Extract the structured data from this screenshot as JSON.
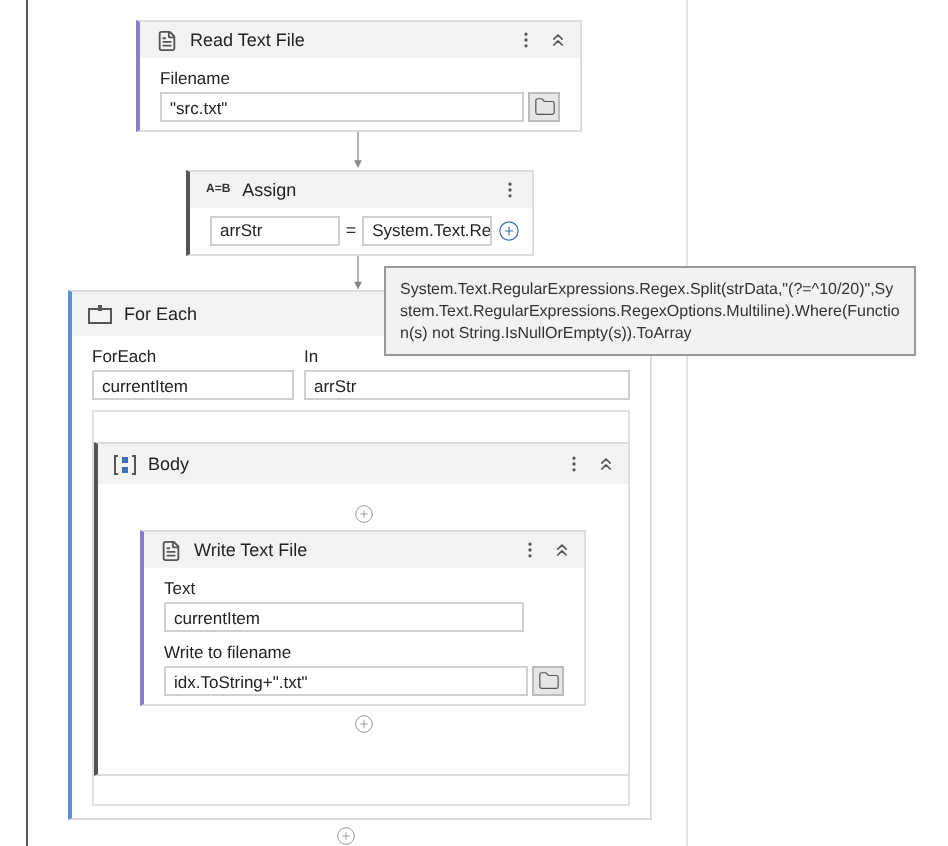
{
  "read_text_file": {
    "title": "Read Text File",
    "field_label": "Filename",
    "field_value": "\"src.txt\""
  },
  "assign": {
    "icon_text": "A=B",
    "title": "Assign",
    "to": "arrStr",
    "operator": "=",
    "value": "System.Text.Re"
  },
  "tooltip": {
    "text": "System.Text.RegularExpressions.Regex.Split(strData,\"(?=^10/20)\",System.Text.RegularExpressions.RegexOptions.Multiline).Where(Function(s) not String.IsNullOrEmpty(s)).ToArray"
  },
  "for_each": {
    "title": "For Each",
    "item_label": "ForEach",
    "item_value": "currentItem",
    "in_label": "In",
    "in_value": "arrStr",
    "body": {
      "title": "Body",
      "activity": {
        "title": "Write Text File",
        "text_label": "Text",
        "text_value": "currentItem",
        "file_label": "Write to filename",
        "file_value": "idx.ToString+\".txt\""
      }
    }
  }
}
